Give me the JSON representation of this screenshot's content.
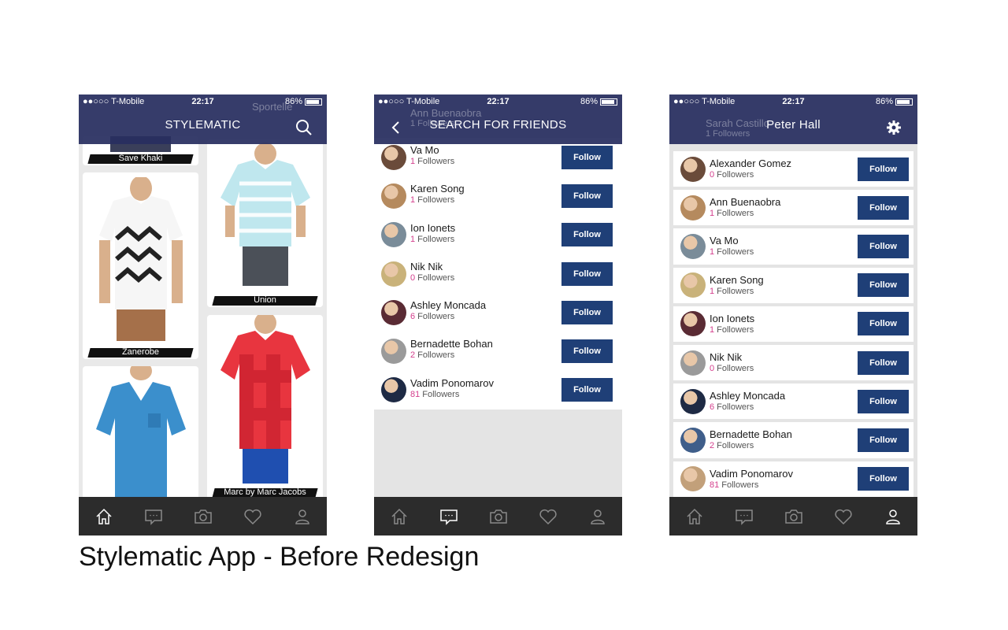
{
  "status_bar": {
    "carrier": "●●○○○ T-Mobile",
    "time": "22:17",
    "battery": "86%"
  },
  "screens": {
    "feed": {
      "title": "STYLEMATIC",
      "products": [
        {
          "brand": "Save Khaki",
          "color": "#8a8a8a"
        },
        {
          "brand": "Union",
          "color": "#bfe7ee"
        },
        {
          "brand": "Zanerobe",
          "color": "#f2f2f2"
        },
        {
          "brand": "Marc by Marc Jacobs",
          "color": "#e8353f"
        },
        {
          "brand": "",
          "color": "#3b8fcc"
        }
      ],
      "ghost_brand": "Sportelle"
    },
    "search": {
      "title": "SEARCH FOR FRIENDS",
      "ghost_name": "Ann Buenaobra",
      "ghost_count": "1 Followers",
      "follow_label": "Follow",
      "followers_label": "Followers",
      "users": [
        {
          "name": "Va Mo",
          "count": "1"
        },
        {
          "name": "Karen Song",
          "count": "1"
        },
        {
          "name": "Ion Ionets",
          "count": "1"
        },
        {
          "name": "Nik Nik",
          "count": "0"
        },
        {
          "name": "Ashley Moncada",
          "count": "6"
        },
        {
          "name": "Bernadette Bohan",
          "count": "2"
        },
        {
          "name": "Vadim Ponomarov",
          "count": "81"
        }
      ]
    },
    "profile": {
      "title": "Peter Hall",
      "ghost_name": "Sarah Castillo",
      "ghost_count": "1 Followers",
      "follow_label": "Follow",
      "followers_label": "Followers",
      "users": [
        {
          "name": "Alexander Gomez",
          "count": "0"
        },
        {
          "name": "Ann Buenaobra",
          "count": "1"
        },
        {
          "name": "Va Mo",
          "count": "1"
        },
        {
          "name": "Karen Song",
          "count": "1"
        },
        {
          "name": "Ion Ionets",
          "count": "1"
        },
        {
          "name": "Nik Nik",
          "count": "0"
        },
        {
          "name": "Ashley Moncada",
          "count": "6"
        },
        {
          "name": "Bernadette Bohan",
          "count": "2"
        },
        {
          "name": "Vadim Ponomarov",
          "count": "81"
        }
      ]
    }
  },
  "tabs": [
    {
      "icon": "home-icon"
    },
    {
      "icon": "chat-icon"
    },
    {
      "icon": "camera-icon"
    },
    {
      "icon": "heart-icon"
    },
    {
      "icon": "user-icon"
    }
  ],
  "caption": "Stylematic App - Before Redesign",
  "colors": {
    "navbar": "#282e60",
    "follow_button": "#1f3f77",
    "tabbar": "#2c2c2c",
    "count_accent": "#d43f8d"
  }
}
